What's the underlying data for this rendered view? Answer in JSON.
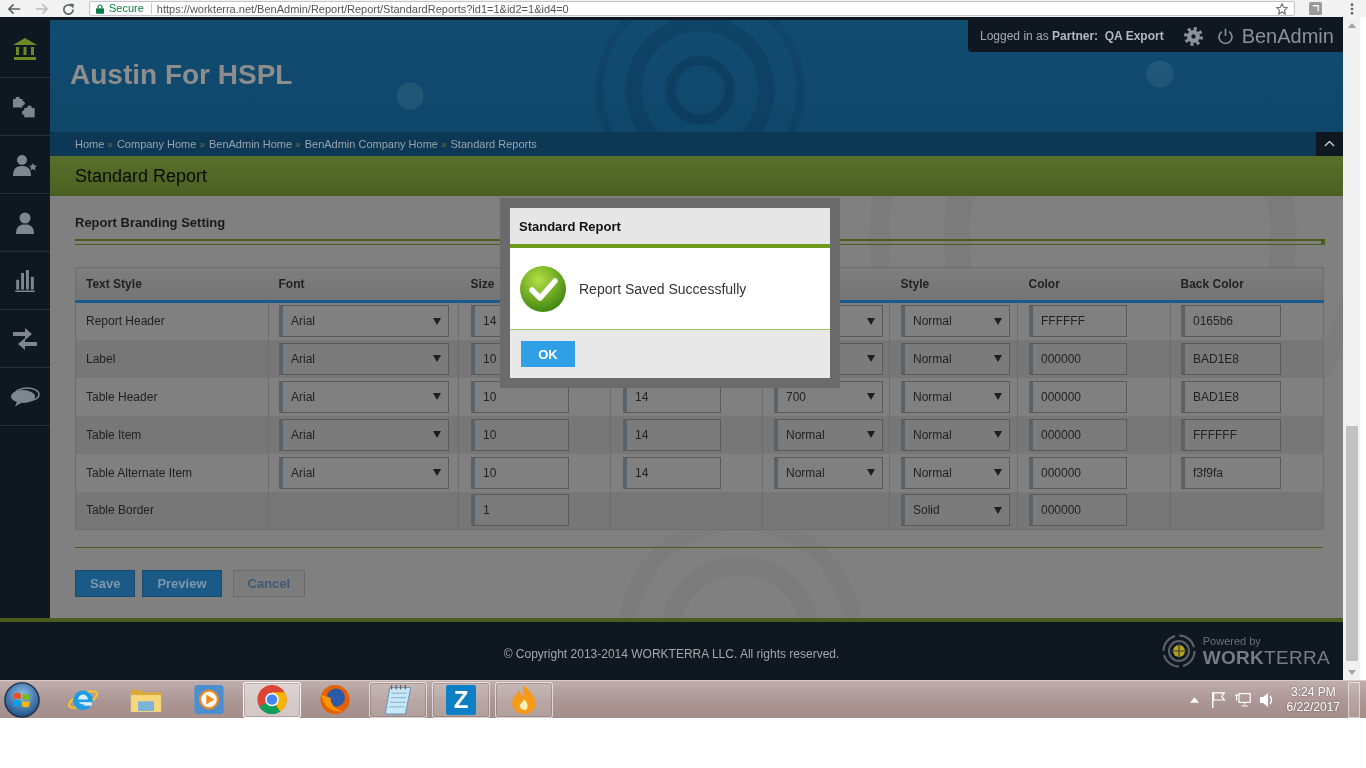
{
  "browser": {
    "security": "Secure",
    "url": "https://workterra.net/BenAdmin/Report/Report/StandardReports?id1=1&id2=1&id4=0"
  },
  "sidebar": {
    "items": [
      {
        "kind": "home",
        "selected": true
      },
      {
        "kind": "puzzle",
        "selected": false
      },
      {
        "kind": "person-star",
        "selected": false
      },
      {
        "kind": "person",
        "selected": false
      },
      {
        "kind": "chart",
        "selected": false
      },
      {
        "kind": "arrows",
        "selected": false
      },
      {
        "kind": "chat",
        "selected": false
      }
    ]
  },
  "header": {
    "title": "Austin For HSPL",
    "user_bar": {
      "login": "Logged in as **Partner:  QA Export**",
      "app_name": "BenAdmin"
    }
  },
  "breadcrumb": {
    "separator": "»",
    "items": [
      "Home",
      "Company Home",
      "BenAdmin Home",
      "BenAdmin Company Home",
      "Standard Reports"
    ]
  },
  "page_title": "Standard Report",
  "section": {
    "title": "Report Branding Setting"
  },
  "table": {
    "columns": [
      {
        "kind": "label",
        "text": "Text Style"
      },
      {
        "kind": "label",
        "text": "Font"
      },
      {
        "kind": "label",
        "text": "Size"
      },
      {
        "kind": "empty"
      },
      {
        "kind": "empty"
      },
      {
        "kind": "label",
        "text": "Style"
      },
      {
        "kind": "label",
        "text": "Color"
      },
      {
        "kind": "label",
        "text": "Back Color"
      }
    ],
    "rows": [
      {
        "cells": [
          {
            "kind": "text",
            "text": "Report Header"
          },
          {
            "kind": "select",
            "value": "Arial"
          },
          {
            "kind": "input",
            "value": "14"
          },
          {
            "kind": "empty"
          },
          {
            "kind": "select"
          },
          {
            "kind": "select",
            "value": "Normal"
          },
          {
            "kind": "input",
            "value": "FFFFFF"
          },
          {
            "kind": "input",
            "value": "0165b6"
          }
        ]
      },
      {
        "cells": [
          {
            "kind": "text",
            "text": "Label"
          },
          {
            "kind": "select",
            "value": "Arial"
          },
          {
            "kind": "input",
            "value": "10"
          },
          {
            "kind": "empty"
          },
          {
            "kind": "select"
          },
          {
            "kind": "select",
            "value": "Normal"
          },
          {
            "kind": "input",
            "value": "000000"
          },
          {
            "kind": "input",
            "value": "BAD1E8"
          }
        ]
      },
      {
        "cells": [
          {
            "kind": "text",
            "text": "Table Header"
          },
          {
            "kind": "select",
            "value": "Arial"
          },
          {
            "kind": "input",
            "value": "10"
          },
          {
            "kind": "input",
            "value": "14"
          },
          {
            "kind": "select",
            "value": "700"
          },
          {
            "kind": "select",
            "value": "Normal"
          },
          {
            "kind": "input",
            "value": "000000"
          },
          {
            "kind": "input",
            "value": "BAD1E8"
          }
        ]
      },
      {
        "cells": [
          {
            "kind": "text",
            "text": "Table Item"
          },
          {
            "kind": "select",
            "value": "Arial"
          },
          {
            "kind": "input",
            "value": "10"
          },
          {
            "kind": "input",
            "value": "14"
          },
          {
            "kind": "select",
            "value": "Normal"
          },
          {
            "kind": "select",
            "value": "Normal"
          },
          {
            "kind": "input",
            "value": "000000"
          },
          {
            "kind": "input",
            "value": "FFFFFF"
          }
        ]
      },
      {
        "cells": [
          {
            "kind": "text",
            "text": "Table Alternate Item"
          },
          {
            "kind": "select",
            "value": "Arial"
          },
          {
            "kind": "input",
            "value": "10"
          },
          {
            "kind": "input",
            "value": "14"
          },
          {
            "kind": "select",
            "value": "Normal"
          },
          {
            "kind": "select",
            "value": "Normal"
          },
          {
            "kind": "input",
            "value": "000000"
          },
          {
            "kind": "input",
            "value": "f3f9fa"
          }
        ]
      },
      {
        "cells": [
          {
            "kind": "text",
            "text": "Table Border"
          },
          {
            "kind": "empty"
          },
          {
            "kind": "input",
            "value": "1"
          },
          {
            "kind": "empty"
          },
          {
            "kind": "empty"
          },
          {
            "kind": "select",
            "value": "Solid"
          },
          {
            "kind": "input",
            "value": "000000"
          },
          {
            "kind": "empty"
          }
        ]
      }
    ]
  },
  "buttons": [
    {
      "label": "Save",
      "kind": "primary"
    },
    {
      "label": "Preview",
      "kind": "primary"
    },
    {
      "label": "Cancel",
      "kind": "secondary"
    }
  ],
  "dialog": {
    "title": "Standard Report",
    "message": "Report Saved Successfully",
    "button": "OK"
  },
  "footer": {
    "copyright": "© Copyright 2013-2014 WORKTERRA LLC. All rights reserved.",
    "tagline": "Powered by",
    "brand": "**WORK**TERRA"
  },
  "taskbar": {
    "apps": [
      {
        "kind": "ie",
        "open": false,
        "selected": false
      },
      {
        "kind": "folder",
        "open": false,
        "selected": false
      },
      {
        "kind": "media",
        "open": false,
        "selected": false
      },
      {
        "kind": "chrome",
        "open": true,
        "selected": true
      },
      {
        "kind": "firefox",
        "open": false,
        "selected": false
      },
      {
        "kind": "notepad",
        "open": true,
        "selected": false
      },
      {
        "kind": "letter",
        "glyph": "Z",
        "open": true,
        "selected": false
      },
      {
        "kind": "flame",
        "open": true,
        "selected": false
      }
    ],
    "clock": {
      "time": "3:24 PM",
      "date": "6/22/2017"
    }
  }
}
